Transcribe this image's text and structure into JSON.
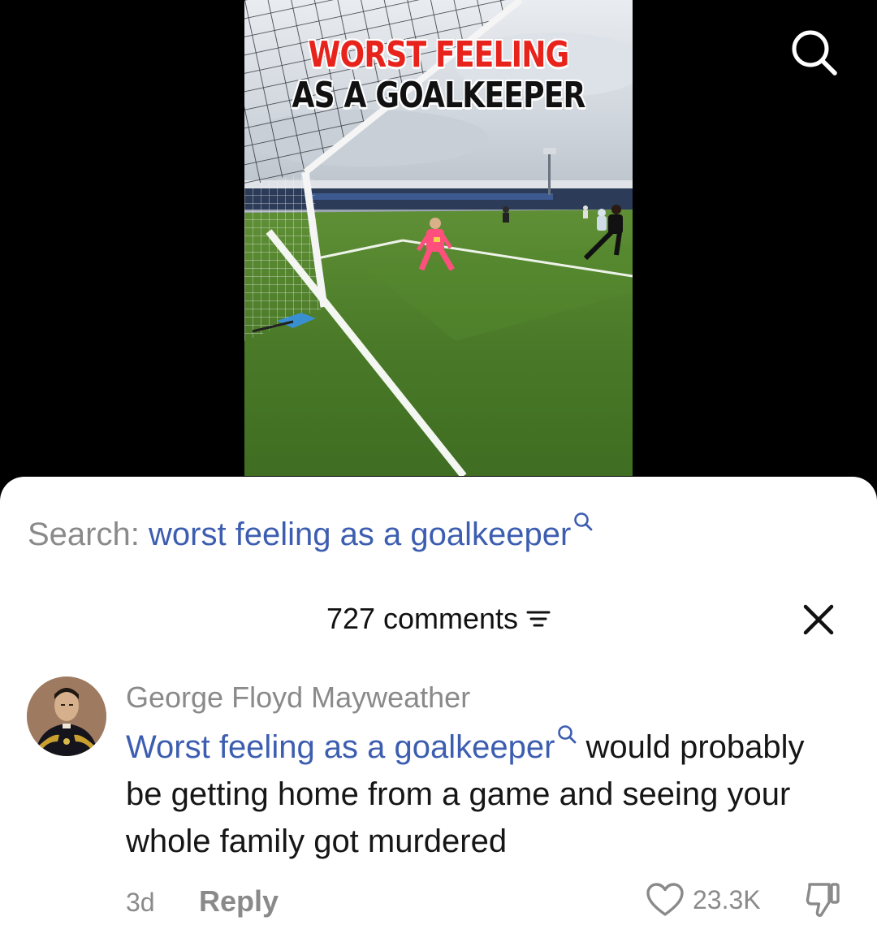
{
  "video": {
    "title_line1": "WORST FEELING",
    "title_line2": "AS A GOALKEEPER"
  },
  "top_bar": {
    "search_icon": "search-icon"
  },
  "sheet": {
    "search_prefix": "Search:",
    "search_query": "worst feeling as a goalkeeper",
    "comment_count": "727 comments",
    "sort_icon": "sort-icon",
    "close_icon": "close-icon"
  },
  "comment": {
    "username": "George Floyd Mayweather",
    "link_text": "Worst feeling as a goalkeeper",
    "body": "would probably be getting home from a game and seeing your whole family got murdered",
    "timestamp": "3d",
    "reply_label": "Reply",
    "like_count": "23.3K",
    "like_icon": "heart-icon",
    "dislike_icon": "thumbs-down-icon"
  },
  "colors": {
    "link_blue": "#3d5eb0",
    "muted_gray": "#8a8a8a",
    "title_red": "#e8231c"
  }
}
